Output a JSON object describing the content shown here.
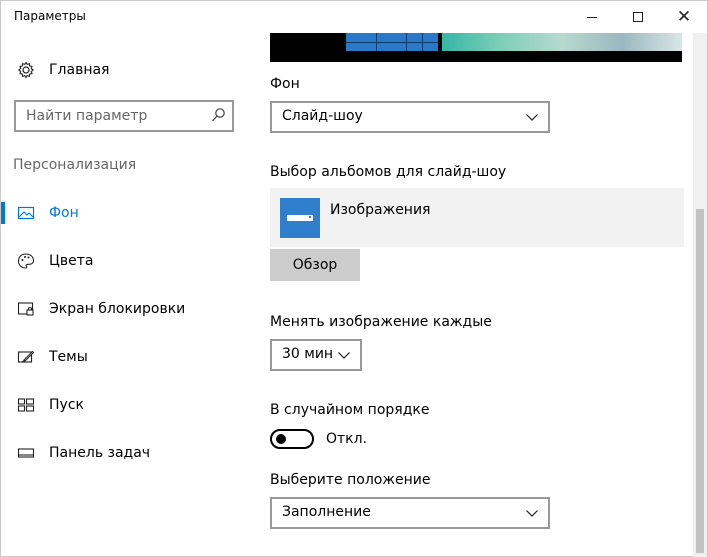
{
  "window": {
    "title": "Параметры",
    "minimize_glyph": "",
    "maximize_glyph": "",
    "close_glyph": "✕"
  },
  "sidebar": {
    "home_label": "Главная",
    "home_icon": "gear-icon",
    "search_placeholder": "Найти параметр",
    "search_icon": "search-icon",
    "section_title": "Персонализация",
    "items": [
      {
        "label": "Фон",
        "icon": "picture-icon",
        "active": true
      },
      {
        "label": "Цвета",
        "icon": "palette-icon",
        "active": false
      },
      {
        "label": "Экран блокировки",
        "icon": "lock-screen-icon",
        "active": false
      },
      {
        "label": "Темы",
        "icon": "brush-icon",
        "active": false
      },
      {
        "label": "Пуск",
        "icon": "start-tiles-icon",
        "active": false
      },
      {
        "label": "Панель задач",
        "icon": "taskbar-icon",
        "active": false
      }
    ]
  },
  "main": {
    "background_label": "Фон",
    "background_value": "Слайд-шоу",
    "albums_label": "Выбор альбомов для слайд-шоу",
    "album_name": "Изображения",
    "album_icon": "folder-icon",
    "browse_button": "Обзор",
    "interval_label": "Менять изображение каждые",
    "interval_value": "30 мин",
    "shuffle_label": "В случайном порядке",
    "shuffle_state": "Откл.",
    "position_label": "Выберите положение",
    "position_value": "Заполнение"
  },
  "colors": {
    "accent": "#0078d7",
    "album_tile": "#2f7fcd"
  }
}
